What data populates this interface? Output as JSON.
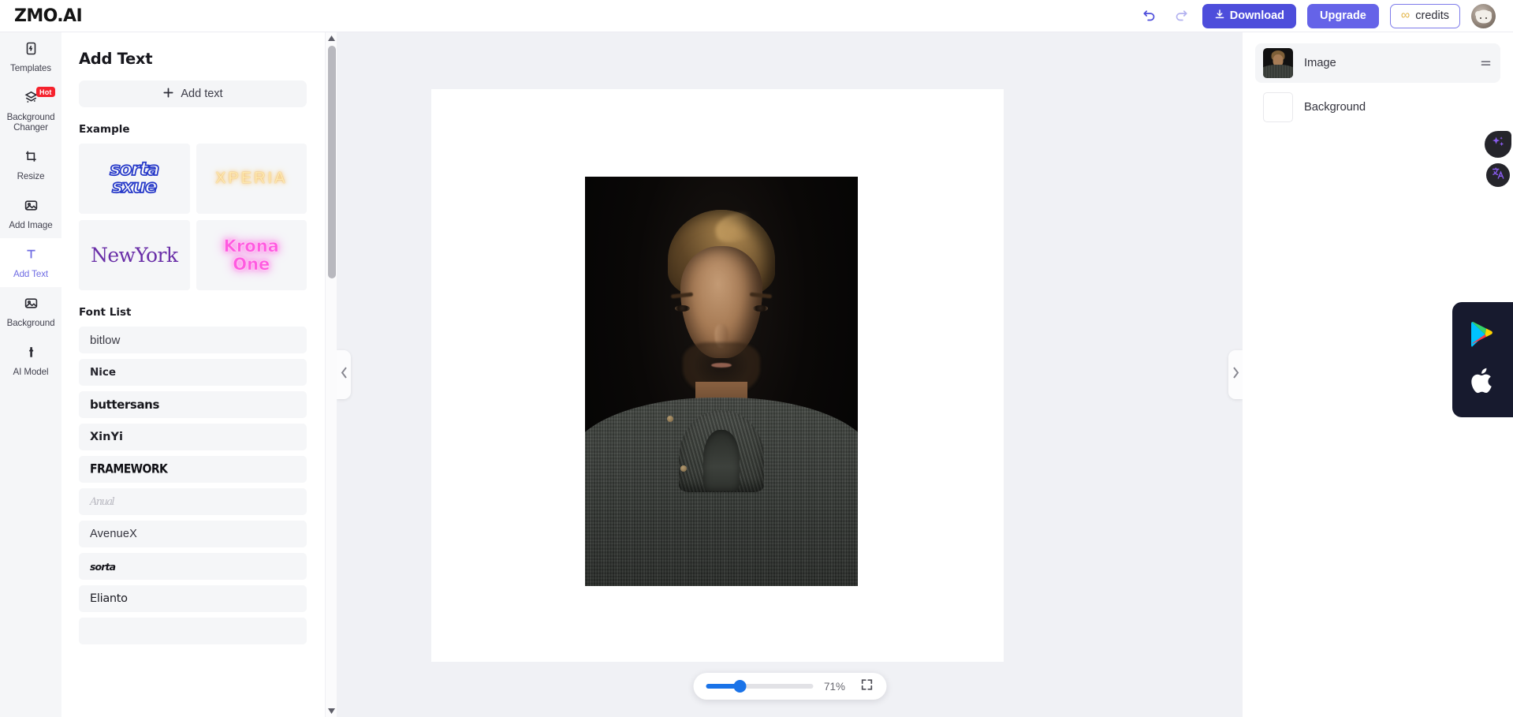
{
  "app": {
    "logo": "ZMO.AI"
  },
  "topbar": {
    "undo_icon": "undo-icon",
    "redo_icon": "redo-icon",
    "download_label": "Download",
    "upgrade_label": "Upgrade",
    "credits_label": "credits",
    "credits_symbol": "∞",
    "avatar_icon": "avatar"
  },
  "sidebar": {
    "items": [
      {
        "label": "Templates",
        "icon": "templates-icon",
        "active": false,
        "badge": ""
      },
      {
        "label": "Background Changer",
        "icon": "layers-icon",
        "active": false,
        "badge": "Hot"
      },
      {
        "label": "Resize",
        "icon": "crop-icon",
        "active": false,
        "badge": ""
      },
      {
        "label": "Add Image",
        "icon": "image-icon",
        "active": false,
        "badge": ""
      },
      {
        "label": "Add Text",
        "icon": "text-t-icon",
        "active": true,
        "badge": ""
      },
      {
        "label": "Background",
        "icon": "image-icon",
        "active": false,
        "badge": ""
      },
      {
        "label": "AI Model",
        "icon": "person-icon",
        "active": false,
        "badge": ""
      }
    ]
  },
  "panel": {
    "title": "Add Text",
    "add_text_label": "Add text",
    "add_text_icon": "plus-icon",
    "example_heading": "Example",
    "examples": [
      {
        "name": "sorta-sxue",
        "line1": "sorta",
        "line2": "sxue",
        "style": "blue-outline"
      },
      {
        "name": "xperia",
        "line1": "XPERIA",
        "line2": "",
        "style": "yellow-glow"
      },
      {
        "name": "newyork",
        "line1": "NewYork",
        "line2": "",
        "style": "purple-serif"
      },
      {
        "name": "krona-one",
        "line1": "Krona",
        "line2": "One",
        "style": "pink-neon"
      }
    ],
    "font_heading": "Font List",
    "fonts": [
      {
        "label": "bitlow",
        "cls": "f-bitlow"
      },
      {
        "label": "Nice",
        "cls": "f-nice"
      },
      {
        "label": "buttersans",
        "cls": "f-butter"
      },
      {
        "label": "XinYi",
        "cls": "f-xinyi"
      },
      {
        "label": "FRAMEWORK",
        "cls": "f-framework"
      },
      {
        "label": "Anual",
        "cls": "f-anual"
      },
      {
        "label": "AvenueX",
        "cls": "f-avenue"
      },
      {
        "label": "sorta",
        "cls": "f-sorta2"
      },
      {
        "label": "Elianto",
        "cls": "f-elianto"
      },
      {
        "label": "",
        "cls": "f-last"
      }
    ]
  },
  "canvas": {
    "collapse_left_icon": "chevron-left-icon",
    "collapse_right_icon": "chevron-right-icon",
    "zoom_value": "71%",
    "zoom_percent": 71,
    "fit_icon": "fit-screen-icon",
    "artboard_background": "#ffffff",
    "stage_background": "#f0f1f5",
    "image_alt": "portrait of a man in a dark grey knit shawl-collar sweater on a black background"
  },
  "layers": {
    "rows": [
      {
        "name": "Image",
        "selected": true,
        "thumb": "portrait-thumbnail",
        "handle_icon": "drag-handle-icon"
      },
      {
        "name": "Background",
        "selected": false,
        "thumb": "white-thumbnail",
        "handle_icon": ""
      }
    ]
  },
  "floating": {
    "ai_icon": "sparkle-ai-icon",
    "translate_icon": "translate-icon"
  },
  "appstore": {
    "google_play_icon": "google-play-icon",
    "apple_icon": "apple-icon"
  },
  "colors": {
    "accent": "#4d4ddb",
    "upgrade": "#6563e8",
    "active_text": "#6f6ce3",
    "hot_badge": "#f5222d",
    "slider": "#1a73e8",
    "rail_bg": "#f5f6f8",
    "stage_bg": "#f0f1f5"
  }
}
